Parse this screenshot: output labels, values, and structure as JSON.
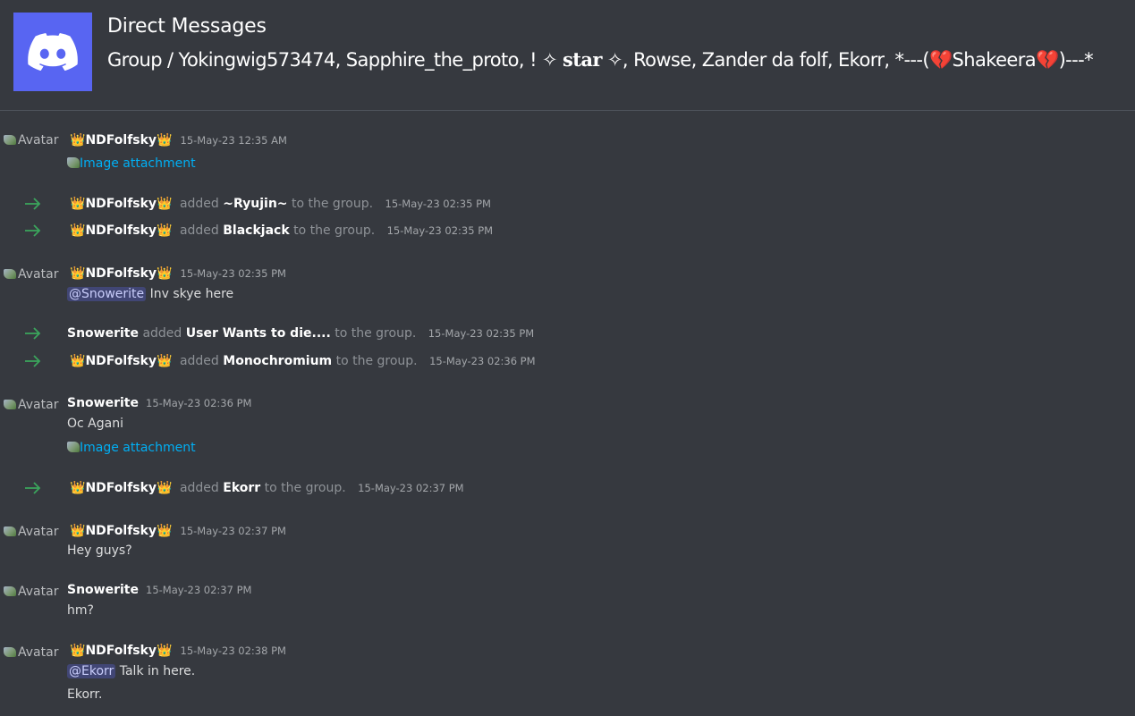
{
  "header": {
    "title": "Direct Messages",
    "subtitle_prefix": "Group / Yokingwig573474, Sapphire_the_proto, ! ✧ ",
    "subtitle_star": "star",
    "subtitle_mid": " ✧, Rowse, Zander da folf, Ekorr, *---(",
    "subtitle_heart": "💔",
    "subtitle_name": "Shakeera",
    "subtitle_end": ")---*"
  },
  "avatar_alt": "Avatar",
  "attachment_alt": "Image attachment",
  "crown": "👑",
  "messages": [
    {
      "author": "NDFolfsky",
      "timestamp": "15-May-23 12:35 AM"
    },
    {
      "author": "NDFolfsky",
      "timestamp": "15-May-23 02:35 PM",
      "mention": "@Snowerite",
      "text": " Inv skye here"
    },
    {
      "author": "Snowerite",
      "timestamp": "15-May-23 02:36 PM",
      "text": "Oc Agani"
    },
    {
      "author": "NDFolfsky",
      "timestamp": "15-May-23 02:37 PM",
      "text": "Hey guys?"
    },
    {
      "author": "Snowerite",
      "timestamp": "15-May-23 02:37 PM",
      "text": "hm?"
    },
    {
      "author": "NDFolfsky",
      "timestamp": "15-May-23 02:38 PM",
      "mention": "@Ekorr",
      "text": " Talk in here.",
      "text2": "Ekorr."
    }
  ],
  "system": [
    {
      "actor": "NDFolfsky",
      "verb": "added",
      "target": "~Ryujin~",
      "suffix": "to the group.",
      "timestamp": "15-May-23 02:35 PM"
    },
    {
      "actor": "NDFolfsky",
      "verb": "added",
      "target": "Blackjack",
      "suffix": "to the group.",
      "timestamp": "15-May-23 02:35 PM"
    },
    {
      "actor": "Snowerite",
      "verb": "added",
      "target": "User Wants to die....",
      "suffix": "to the group.",
      "timestamp": "15-May-23 02:35 PM"
    },
    {
      "actor": "NDFolfsky",
      "verb": "added",
      "target": "Monochromium",
      "suffix": "to the group.",
      "timestamp": "15-May-23 02:36 PM"
    },
    {
      "actor": "NDFolfsky",
      "verb": "added",
      "target": "Ekorr",
      "suffix": "to the group.",
      "timestamp": "15-May-23 02:37 PM"
    }
  ],
  "colors": {
    "background": "#36393f",
    "logo": "#5865f2",
    "link": "#00aff4",
    "arrow": "#3ba55c",
    "mention_bg": "#414675"
  }
}
